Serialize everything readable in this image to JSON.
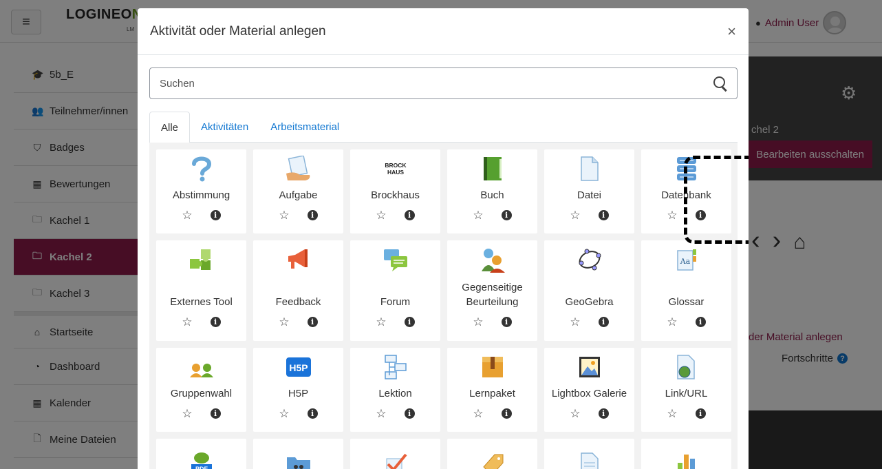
{
  "header": {
    "logo_main": "LOGINEO",
    "logo_accent": "NI",
    "logo_sub": "LM",
    "user_name": "Admin User"
  },
  "sidebar": {
    "items": [
      {
        "label": "5b_E",
        "icon": "graduation-cap-icon",
        "glyph": "🎓"
      },
      {
        "label": "Teilnehmer/innen",
        "icon": "users-icon",
        "glyph": "👥"
      },
      {
        "label": "Badges",
        "icon": "shield-icon",
        "glyph": "⛉"
      },
      {
        "label": "Bewertungen",
        "icon": "table-icon",
        "glyph": "▦"
      },
      {
        "label": "Kachel 1",
        "icon": "folder-icon",
        "glyph": "🗀"
      },
      {
        "label": "Kachel 2",
        "icon": "folder-icon",
        "glyph": "🗀"
      },
      {
        "label": "Kachel 3",
        "icon": "folder-icon",
        "glyph": "🗀"
      },
      {
        "label": "Startseite",
        "icon": "home-icon",
        "glyph": "⌂"
      },
      {
        "label": "Dashboard",
        "icon": "dashboard-icon",
        "glyph": "◔"
      },
      {
        "label": "Kalender",
        "icon": "calendar-icon",
        "glyph": "▦"
      },
      {
        "label": "Meine Dateien",
        "icon": "file-icon",
        "glyph": "🗋"
      }
    ],
    "active_index": 5
  },
  "background": {
    "kachel_label": "chel 2",
    "edit_button": "Bearbeiten ausschalten",
    "add_link": "der Material anlegen",
    "progress_label": "Fortschritte"
  },
  "modal": {
    "title": "Aktivität oder Material anlegen",
    "search_placeholder": "Suchen",
    "tabs": [
      "Alle",
      "Aktivitäten",
      "Arbeitsmaterial"
    ],
    "active_tab": 0,
    "items": [
      {
        "label": "Abstimmung",
        "icon": "question-icon"
      },
      {
        "label": "Aufgabe",
        "icon": "assignment-icon"
      },
      {
        "label": "Brockhaus",
        "icon": "brockhaus-logo-icon",
        "logo_text": "BROCK HAUS"
      },
      {
        "label": "Buch",
        "icon": "book-icon"
      },
      {
        "label": "Datei",
        "icon": "file-icon"
      },
      {
        "label": "Datenbank",
        "icon": "database-icon"
      },
      {
        "label": "Externes Tool",
        "icon": "puzzle-icon"
      },
      {
        "label": "Feedback",
        "icon": "megaphone-icon"
      },
      {
        "label": "Forum",
        "icon": "forum-icon"
      },
      {
        "label": "Gegenseitige Beurteilung",
        "icon": "peer-assessment-icon"
      },
      {
        "label": "GeoGebra",
        "icon": "geogebra-icon"
      },
      {
        "label": "Glossar",
        "icon": "glossary-icon"
      },
      {
        "label": "Gruppenwahl",
        "icon": "group-choice-icon"
      },
      {
        "label": "H5P",
        "icon": "h5p-icon",
        "logo_text": "H5P"
      },
      {
        "label": "Lektion",
        "icon": "lesson-icon"
      },
      {
        "label": "Lernpaket",
        "icon": "package-icon"
      },
      {
        "label": "Lightbox Galerie",
        "icon": "gallery-icon"
      },
      {
        "label": "Link/URL",
        "icon": "link-url-icon"
      }
    ],
    "partial_row_icons": [
      "pdf-icon",
      "folder-people-icon",
      "checkmark-icon",
      "tag-icon",
      "page-icon",
      "chart-icon"
    ],
    "partial_row_pdf_text": "PDF"
  },
  "colors": {
    "brand": "#8e1a4a",
    "link": "#1177d1",
    "grid_bg": "#f2f2f2"
  }
}
